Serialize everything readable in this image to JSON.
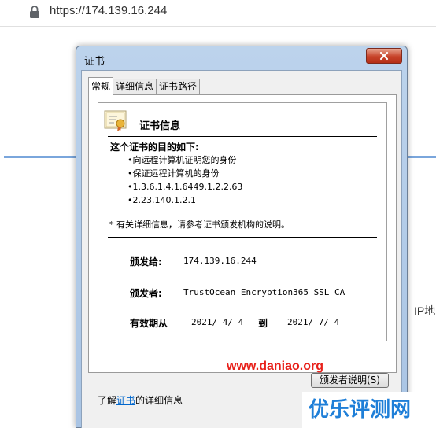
{
  "browser": {
    "url": "https://174.139.16.244",
    "side_text": "IP地"
  },
  "dialog": {
    "title": "证书",
    "tabs": [
      "常规",
      "详细信息",
      "证书路径"
    ],
    "header": "证书信息",
    "purpose_title": "这个证书的目的如下:",
    "purposes": [
      "•向远程计算机证明您的身份",
      "•保证远程计算机的身份",
      "•1.3.6.1.4.1.6449.1.2.2.63",
      "•2.23.140.1.2.1"
    ],
    "note": "* 有关详细信息，请参考证书颁发机构的说明。",
    "issued_to_label": "颁发给:",
    "issued_to_value": "174.139.16.244",
    "issued_by_label": "颁发者:",
    "issued_by_value": "TrustOcean Encryption365 SSL CA",
    "valid_label": "有效期从",
    "valid_from": "2021/ 4/ 4",
    "valid_to_label": "到",
    "valid_to": "2021/ 7/ 4",
    "issuer_statement_button": "颁发者说明(S)",
    "learn_prefix": "了解",
    "learn_link": "证书",
    "learn_suffix": "的详细信息"
  },
  "watermark": "www.daniao.org",
  "brand": "优乐评测网"
}
